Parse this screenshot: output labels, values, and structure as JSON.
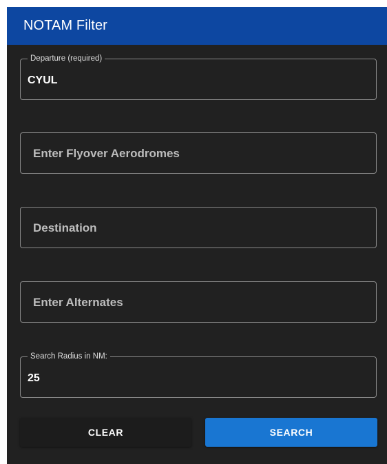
{
  "header": {
    "title": "NOTAM Filter"
  },
  "departure": {
    "label": "Departure (required)",
    "value": "CYUL"
  },
  "flyover": {
    "placeholder": "Enter Flyover Aerodromes"
  },
  "destination": {
    "placeholder": "Destination"
  },
  "alternates": {
    "placeholder": "Enter Alternates"
  },
  "radius": {
    "label": "Search Radius in NM:",
    "value": "25"
  },
  "actions": {
    "clear_label": "CLEAR",
    "search_label": "SEARCH"
  },
  "colors": {
    "header_bg": "#0d47a1",
    "panel_bg": "#212121",
    "search_button": "#1976d2"
  }
}
